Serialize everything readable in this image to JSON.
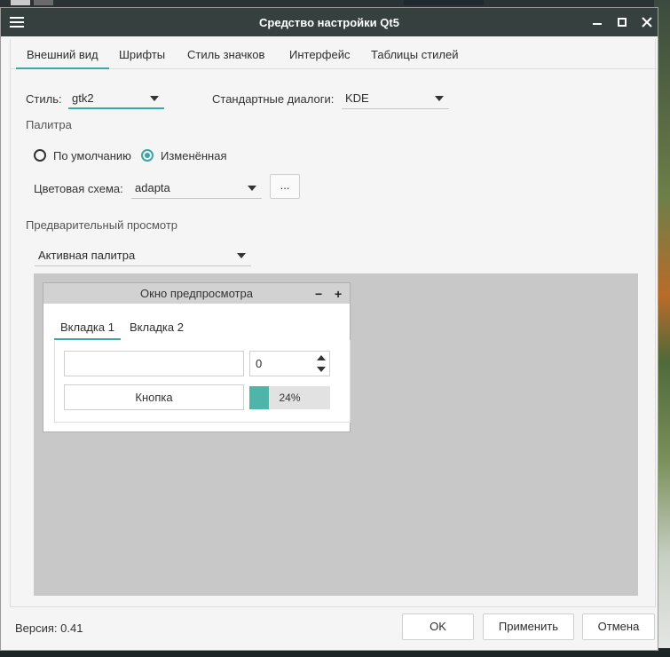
{
  "window": {
    "title": "Средство настройки Qt5",
    "version_label": "Версия: 0.41"
  },
  "tabs": [
    {
      "label": "Внешний вид",
      "active": true
    },
    {
      "label": "Шрифты",
      "active": false
    },
    {
      "label": "Стиль значков",
      "active": false
    },
    {
      "label": "Интерфейс",
      "active": false
    },
    {
      "label": "Таблицы стилей",
      "active": false
    }
  ],
  "appearance": {
    "style_label": "Стиль:",
    "style_value": "gtk2",
    "dialogs_label": "Стандартные диалоги:",
    "dialogs_value": "KDE",
    "palette_heading": "Палитра",
    "radio_default": "По умолчанию",
    "radio_custom": "Изменённая",
    "radio_selected": "custom",
    "color_scheme_label": "Цветовая схема:",
    "color_scheme_value": "adapta",
    "color_scheme_button": "...",
    "preview_heading": "Предварительный просмотр",
    "palette_select_value": "Активная палитра"
  },
  "preview": {
    "title": "Окно предпросмотра",
    "minimize": "−",
    "maximize": "+",
    "tab1": "Вкладка 1",
    "tab2": "Вкладка 2",
    "line_edit": "",
    "spin_value": "0",
    "button": "Кнопка",
    "progress_percent": 24,
    "progress_label": "24%"
  },
  "buttons": {
    "ok": "OK",
    "apply": "Применить",
    "cancel": "Отмена"
  },
  "colors": {
    "accent": "#3ba6a5",
    "titlebar": "#35403f",
    "progress_fill": "#4fb5ab"
  }
}
